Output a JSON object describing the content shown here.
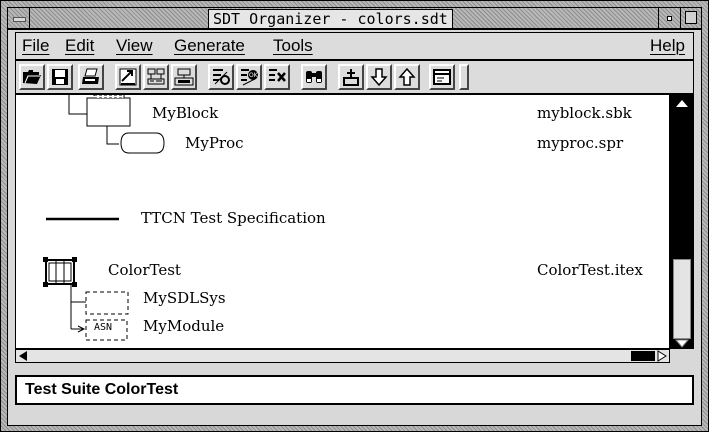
{
  "window": {
    "title": "SDT Organizer - colors.sdt"
  },
  "menubar": {
    "items": [
      "File",
      "Edit",
      "View",
      "Generate",
      "Tools"
    ],
    "help": "Help"
  },
  "toolbar": {
    "icons": [
      "open-folder-icon",
      "save-icon",
      "print-icon",
      "connect-icon",
      "edit-icon",
      "diagram-icon",
      "analyze-icon",
      "validate-icon",
      "remove-icon",
      "find-icon",
      "add-icon",
      "move-down-icon",
      "move-up-icon",
      "window-icon"
    ]
  },
  "tree": {
    "items": [
      {
        "name": "MyBlock",
        "file": "myblock.sbk"
      },
      {
        "name": "MyProc",
        "file": "myproc.spr"
      },
      {
        "name": "TTCN Test Specification",
        "file": ""
      },
      {
        "name": "ColorTest",
        "file": "ColorTest.itex"
      },
      {
        "name": "MySDLSys",
        "file": ""
      },
      {
        "name": "MyModule",
        "file": ""
      }
    ],
    "asn_label": "ASN"
  },
  "status": {
    "text": "Test Suite ColorTest"
  }
}
